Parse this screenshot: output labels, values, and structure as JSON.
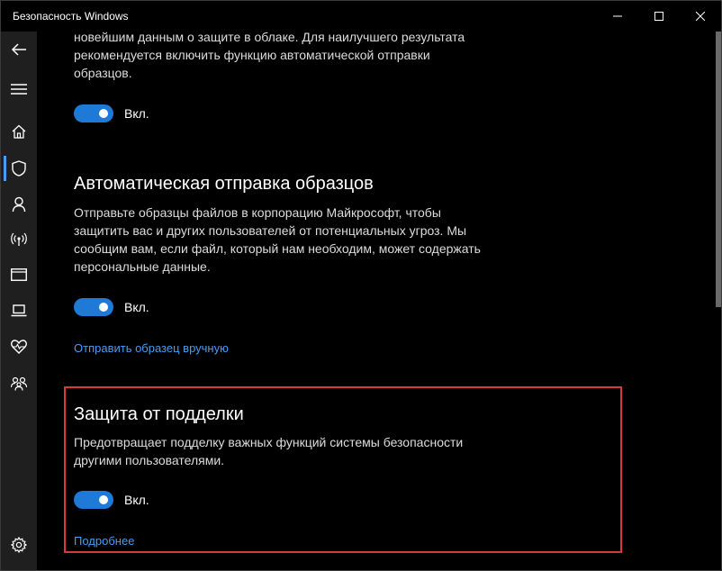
{
  "window": {
    "title": "Безопасность Windows"
  },
  "sidebar": {
    "items": [
      {
        "name": "back-arrow-icon"
      },
      {
        "name": "hamburger-menu-icon"
      },
      {
        "name": "home-icon"
      },
      {
        "name": "shield-icon",
        "active": true
      },
      {
        "name": "person-icon"
      },
      {
        "name": "wireless-icon"
      },
      {
        "name": "app-browser-icon"
      },
      {
        "name": "laptop-icon"
      },
      {
        "name": "heart-icon"
      },
      {
        "name": "family-icon"
      },
      {
        "name": "gear-icon"
      }
    ]
  },
  "cloud_section": {
    "description_lines": [
      "новейшим данным о защите в облаке. Для наилучшего результата",
      "рекомендуется включить функцию автоматической отправки",
      "образцов."
    ],
    "toggle_label": "Вкл."
  },
  "sample_section": {
    "title": "Автоматическая отправка образцов",
    "description_lines": [
      "Отправьте образцы файлов в корпорацию Майкрософт, чтобы",
      "защитить вас и других пользователей от потенциальных угроз. Мы",
      "сообщим вам, если файл, который нам необходим, может содержать",
      "персональные данные."
    ],
    "toggle_label": "Вкл.",
    "link": "Отправить образец вручную"
  },
  "tamper_section": {
    "title": "Защита от подделки",
    "description_lines": [
      "Предотвращает подделку важных функций системы безопасности",
      "другими пользователями."
    ],
    "toggle_label": "Вкл.",
    "link": "Подробнее"
  },
  "colors": {
    "accent": "#1e7ad6",
    "link": "#4a9cf0",
    "highlight": "#d9393b"
  }
}
